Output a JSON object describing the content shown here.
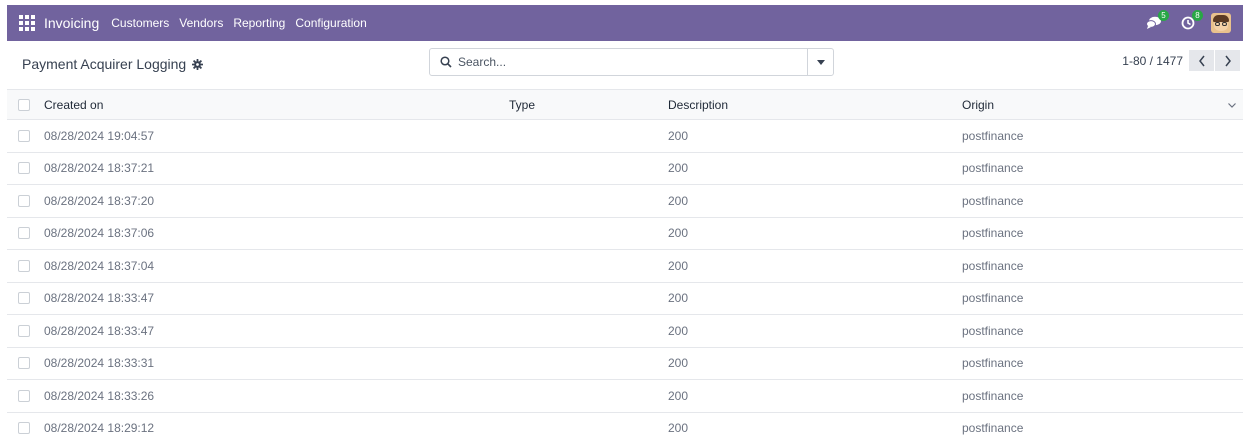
{
  "navbar": {
    "app_name": "Invoicing",
    "menu": [
      "Customers",
      "Vendors",
      "Reporting",
      "Configuration"
    ],
    "messages_count": "5",
    "activities_count": "8",
    "accent_color": "#71639e"
  },
  "control_panel": {
    "title": "Payment Acquirer Logging",
    "search_placeholder": "Search...",
    "pager_value": "1-80 / 1477"
  },
  "table": {
    "columns": [
      "Created on",
      "Type",
      "Description",
      "Origin"
    ],
    "rows": [
      {
        "created_on": "08/28/2024 19:04:57",
        "type": "",
        "description": "200",
        "origin": "postfinance"
      },
      {
        "created_on": "08/28/2024 18:37:21",
        "type": "",
        "description": "200",
        "origin": "postfinance"
      },
      {
        "created_on": "08/28/2024 18:37:20",
        "type": "",
        "description": "200",
        "origin": "postfinance"
      },
      {
        "created_on": "08/28/2024 18:37:06",
        "type": "",
        "description": "200",
        "origin": "postfinance"
      },
      {
        "created_on": "08/28/2024 18:37:04",
        "type": "",
        "description": "200",
        "origin": "postfinance"
      },
      {
        "created_on": "08/28/2024 18:33:47",
        "type": "",
        "description": "200",
        "origin": "postfinance"
      },
      {
        "created_on": "08/28/2024 18:33:47",
        "type": "",
        "description": "200",
        "origin": "postfinance"
      },
      {
        "created_on": "08/28/2024 18:33:31",
        "type": "",
        "description": "200",
        "origin": "postfinance"
      },
      {
        "created_on": "08/28/2024 18:33:26",
        "type": "",
        "description": "200",
        "origin": "postfinance"
      },
      {
        "created_on": "08/28/2024 18:29:12",
        "type": "",
        "description": "200",
        "origin": "postfinance"
      }
    ]
  }
}
